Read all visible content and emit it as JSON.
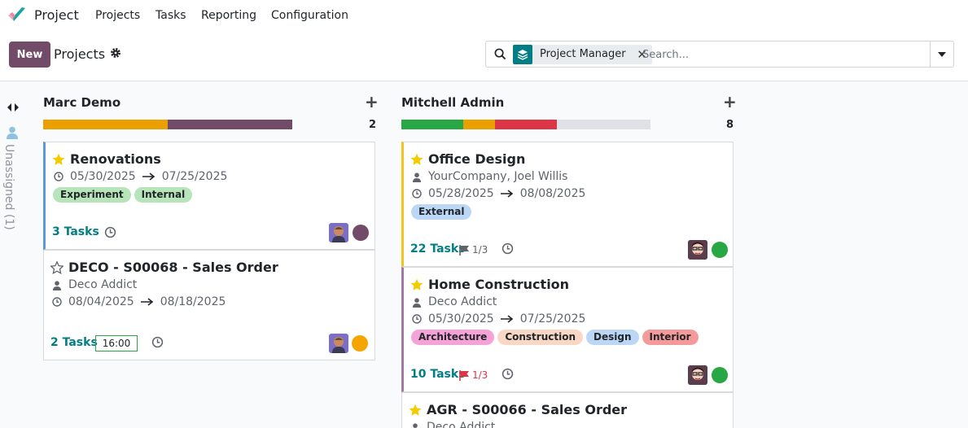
{
  "nav": {
    "app_name": "Project",
    "menu": [
      "Projects",
      "Tasks",
      "Reporting",
      "Configuration"
    ]
  },
  "control_panel": {
    "new_label": "New",
    "breadcrumb": "Projects",
    "facet_label": "Project Manager",
    "search_placeholder": "Search..."
  },
  "folded_column": {
    "label": "Unassigned (1)"
  },
  "columns": [
    {
      "title": "Marc Demo",
      "count": "2",
      "progress": [
        {
          "color": "#e9a000",
          "fraction": 0.5
        },
        {
          "color": "#714b67",
          "fraction": 0.5
        }
      ],
      "cards": [
        {
          "title": "Renovations",
          "starred": true,
          "dates": {
            "start": "05/30/2025",
            "end": "07/25/2025"
          },
          "tags": [
            {
              "label": "Experiment",
              "color": "#b7e4b9"
            },
            {
              "label": "Internal",
              "color": "#b7e4b9"
            }
          ],
          "tasks": "3 Tasks",
          "status_color": "#714b67",
          "accent": "#5b9bd5"
        },
        {
          "title": "DECO - S00068 - Sales Order",
          "starred": false,
          "partner": "Deco Addict",
          "dates": {
            "start": "08/04/2025",
            "end": "08/18/2025"
          },
          "tasks": "2 Tasks",
          "time": "16:00",
          "status_color": "#f5a500"
        }
      ]
    },
    {
      "title": "Mitchell Admin",
      "count": "8",
      "progress": [
        {
          "color": "#28a745",
          "fraction": 0.25
        },
        {
          "color": "#e9a000",
          "fraction": 0.125
        },
        {
          "color": "#dc3545",
          "fraction": 0.25
        },
        {
          "color": "#dee2e6",
          "fraction": 0.375
        }
      ],
      "cards": [
        {
          "title": "Office Design",
          "starred": true,
          "partner": "YourCompany, Joel Willis",
          "dates": {
            "start": "05/28/2025",
            "end": "08/08/2025"
          },
          "tags": [
            {
              "label": "External",
              "color": "#bcd7f5"
            }
          ],
          "tasks": "22 Tasks",
          "milestone": "1/3",
          "milestone_color": "#5f636a",
          "status_color": "#28a745",
          "accent": "#f0c419"
        },
        {
          "title": "Home Construction",
          "starred": true,
          "partner": "Deco Addict",
          "dates": {
            "start": "05/30/2025",
            "end": "07/25/2025"
          },
          "tags": [
            {
              "label": "Architecture",
              "color": "#f5a3d7"
            },
            {
              "label": "Construction",
              "color": "#f8d7c4"
            },
            {
              "label": "Design",
              "color": "#bcd7f5"
            },
            {
              "label": "Interior",
              "color": "#f59a9a"
            }
          ],
          "tasks": "10 Tasks",
          "milestone": "1/3",
          "milestone_color": "#dc3545",
          "status_color": "#28a745",
          "accent": "#a17aa3"
        },
        {
          "title": "AGR - S00066 - Sales Order",
          "starred": true,
          "partner": "Deco Addict"
        }
      ]
    }
  ]
}
